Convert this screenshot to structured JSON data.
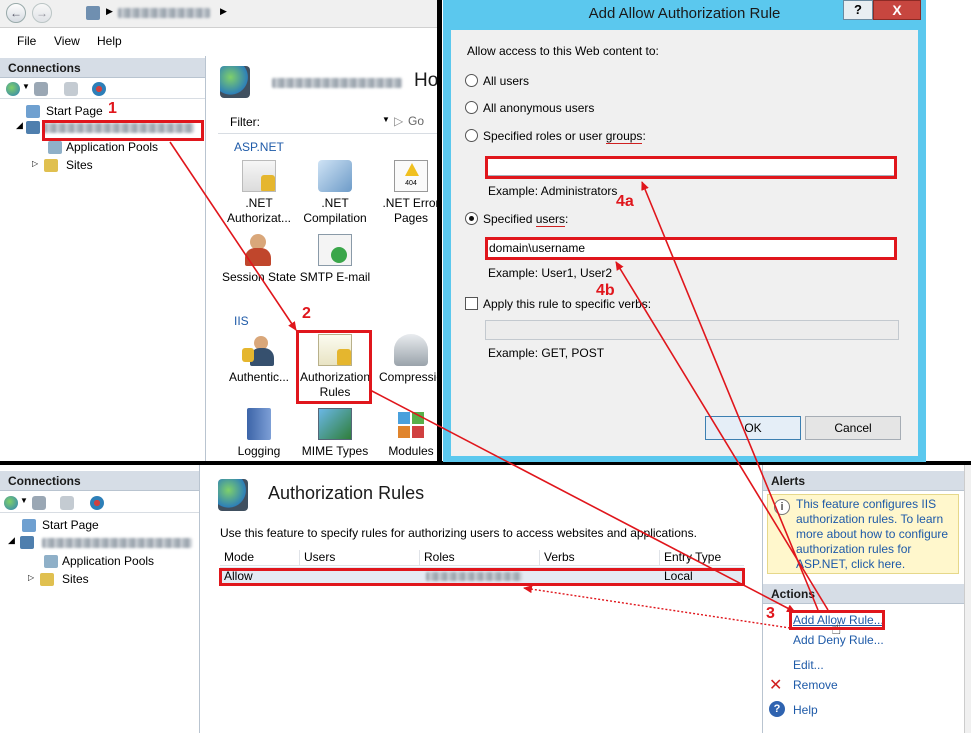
{
  "top_window": {
    "address_text": "",
    "menu": [
      "File",
      "View",
      "Help"
    ],
    "connections_title": "Connections",
    "tree": {
      "start_page": "Start Page",
      "server": "",
      "app_pools": "Application Pools",
      "sites": "Sites"
    },
    "home_title_suffix": "Ho",
    "filter_label": "Filter:",
    "go_label": "Go",
    "group_aspnet": "ASP.NET",
    "group_iis": "IIS",
    "aspnet_items": [
      {
        "label": ".NET Authorizat...",
        "icon": "dotnet-authorization-icon"
      },
      {
        "label": ".NET Compilation",
        "icon": "dotnet-compilation-icon"
      },
      {
        "label": ".NET Error Pages",
        "icon": "dotnet-error-pages-icon"
      },
      {
        "label": "Session State",
        "icon": "session-state-icon"
      },
      {
        "label": "SMTP E-mail",
        "icon": "smtp-email-icon"
      }
    ],
    "iis_items": [
      {
        "label": "Authentic...",
        "icon": "authentication-icon"
      },
      {
        "label": "Authorization Rules",
        "icon": "authorization-rules-icon"
      },
      {
        "label": "Compressio",
        "icon": "compression-icon"
      },
      {
        "label": "Logging",
        "icon": "logging-icon"
      },
      {
        "label": "MIME Types",
        "icon": "mime-types-icon"
      },
      {
        "label": "Modules",
        "icon": "modules-icon"
      }
    ]
  },
  "dialog": {
    "title": "Add Allow Authorization Rule",
    "help_btn": "?",
    "close_btn": "X",
    "prompt": "Allow access to this Web content to:",
    "opt_all_users": "All users",
    "opt_anon_users": "All anonymous users",
    "opt_roles_prefix": "Specified roles or user ",
    "opt_roles_link": "groups",
    "opt_roles_suffix": ":",
    "roles_value": "",
    "roles_example": "Example: Administrators",
    "opt_users_prefix": "Specified ",
    "opt_users_link": "users",
    "opt_users_suffix": ":",
    "users_value": "domain\\username",
    "users_example": "Example: User1, User2",
    "verbs_label": "Apply this rule to specific verbs:",
    "verbs_value": "",
    "verbs_example": "Example: GET, POST",
    "ok": "OK",
    "cancel": "Cancel",
    "selected_option": "users"
  },
  "bottom_window": {
    "connections_title": "Connections",
    "tree": {
      "start_page": "Start Page",
      "server": "",
      "app_pools": "Application Pools",
      "sites": "Sites"
    },
    "page_title": "Authorization Rules",
    "description": "Use this feature to specify rules for authorizing users to access websites and applications.",
    "columns": [
      "Mode",
      "Users",
      "Roles",
      "Verbs",
      "Entry Type"
    ],
    "rows": [
      {
        "mode": "Allow",
        "users": "",
        "roles": "",
        "verbs": "",
        "entry_type": "Local"
      }
    ],
    "alerts_title": "Alerts",
    "alert_text": "This feature configures IIS authorization rules. To learn more about how to configure authorization rules for ASP.NET, click here.",
    "actions_title": "Actions",
    "actions": {
      "add_allow": "Add Allow Rule...",
      "add_deny": "Add Deny Rule...",
      "edit": "Edit...",
      "remove": "Remove",
      "help": "Help"
    }
  },
  "annotations": {
    "step1": "1",
    "step2": "2",
    "step3": "3",
    "step4a": "4a",
    "step4b": "4b"
  },
  "colors": {
    "annotation_red": "#e0161c",
    "dialog_frame": "#5bc8ee",
    "link_blue": "#1e5aa8",
    "pane_header": "#d6dde6",
    "alert_bg": "#fff7cc"
  }
}
